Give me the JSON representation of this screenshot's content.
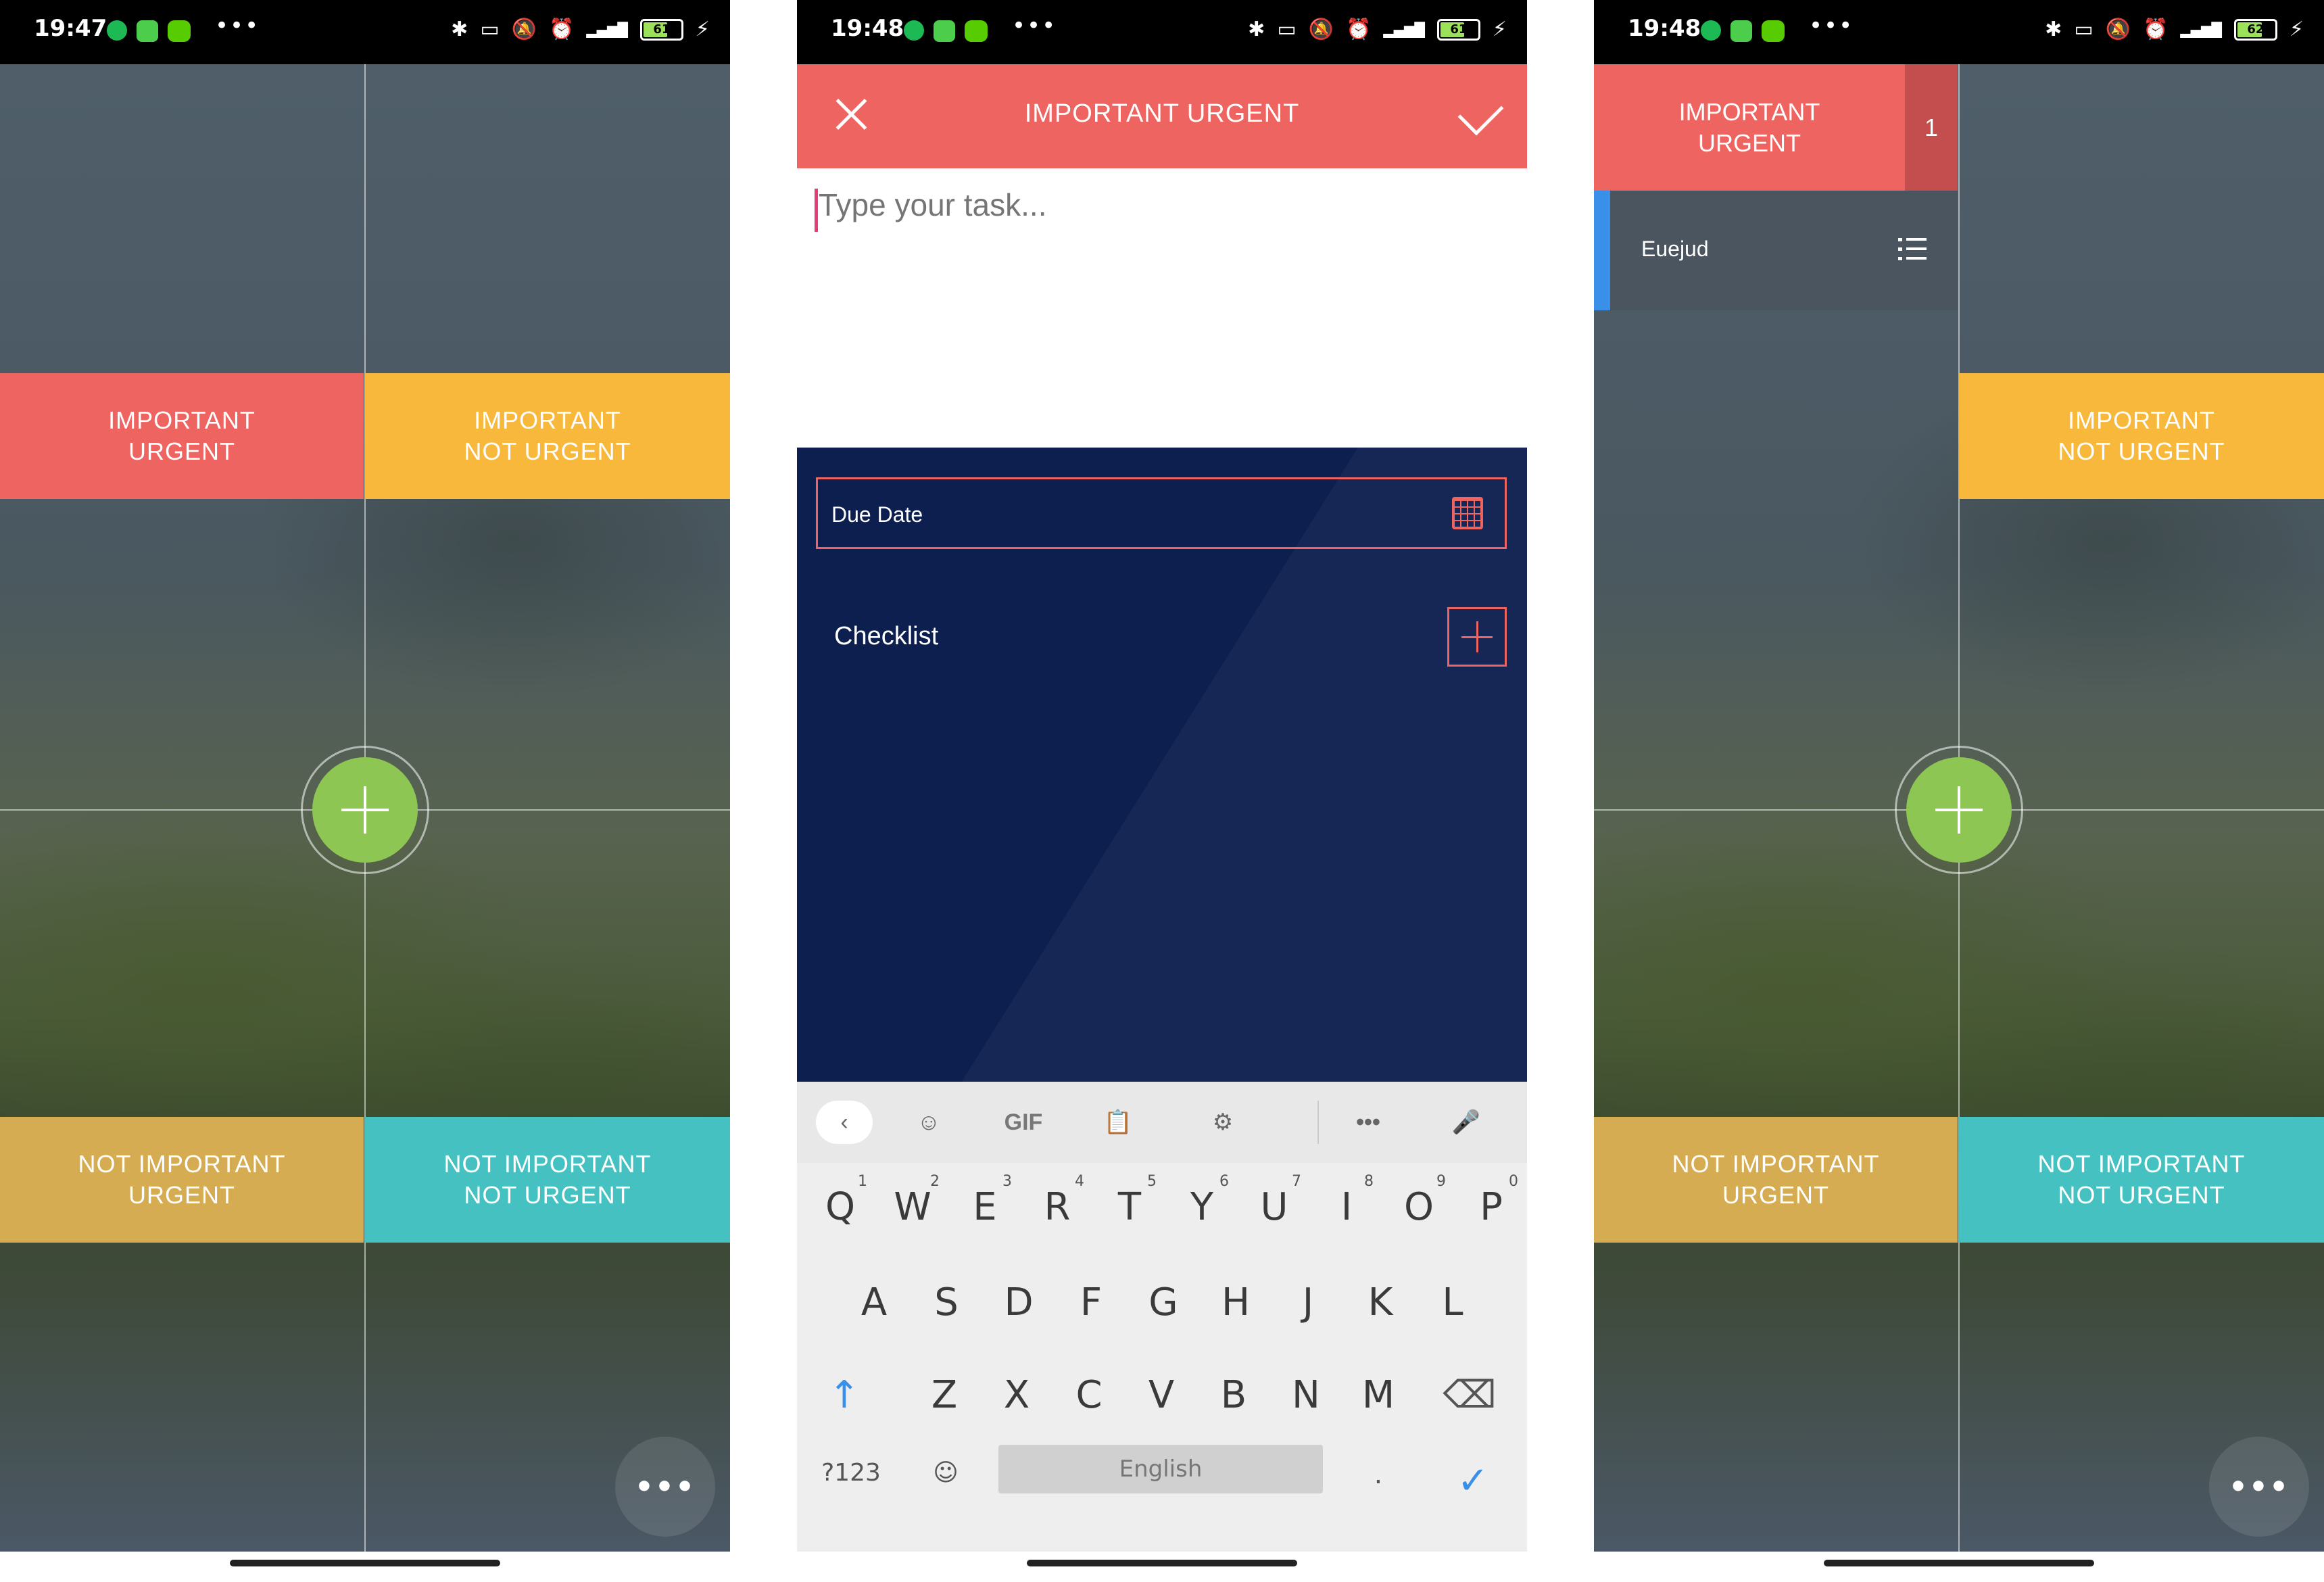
{
  "screens": [
    {
      "status": {
        "time": "19:47",
        "battery": "61"
      },
      "quadrants": {
        "q1": [
          "IMPORTANT",
          "URGENT"
        ],
        "q2": [
          "IMPORTANT",
          "NOT URGENT"
        ],
        "q3": [
          "NOT IMPORTANT",
          "URGENT"
        ],
        "q4": [
          "NOT IMPORTANT",
          "NOT URGENT"
        ]
      }
    },
    {
      "status": {
        "time": "19:48",
        "battery": "61"
      },
      "header": {
        "title": "IMPORTANT URGENT"
      },
      "task_input": {
        "placeholder": "Type your task..."
      },
      "due_date": {
        "label": "Due Date"
      },
      "checklist": {
        "label": "Checklist"
      },
      "keyboard": {
        "gif_label": "GIF",
        "row1": [
          [
            "Q",
            "1"
          ],
          [
            "W",
            "2"
          ],
          [
            "E",
            "3"
          ],
          [
            "R",
            "4"
          ],
          [
            "T",
            "5"
          ],
          [
            "Y",
            "6"
          ],
          [
            "U",
            "7"
          ],
          [
            "I",
            "8"
          ],
          [
            "O",
            "9"
          ],
          [
            "P",
            "0"
          ]
        ],
        "row2": [
          "A",
          "S",
          "D",
          "F",
          "G",
          "H",
          "J",
          "K",
          "L"
        ],
        "row3": [
          "Z",
          "X",
          "C",
          "V",
          "B",
          "N",
          "M"
        ],
        "symbols_label": "?123",
        "space_label": "English",
        "period": "."
      }
    },
    {
      "status": {
        "time": "19:48",
        "battery": "62"
      },
      "list_header": [
        "IMPORTANT",
        "URGENT"
      ],
      "task_count": "1",
      "task_name": "Euejud",
      "quadrants": {
        "q2": [
          "IMPORTANT",
          "NOT URGENT"
        ],
        "q3": [
          "NOT IMPORTANT",
          "URGENT"
        ],
        "q4": [
          "NOT IMPORTANT",
          "NOT URGENT"
        ]
      }
    }
  ],
  "colors": {
    "red": "#ee6461",
    "orange": "#f8b83c",
    "mustard": "#d6ac52",
    "teal": "#45c1c1",
    "fab_green": "#8dc653",
    "panel_navy": "#0d1f4f",
    "task_accent": "#3a8fe8"
  },
  "icons": {
    "status": [
      "spotify-icon",
      "app-icon",
      "duolingo-icon",
      "more-dots-icon",
      "bluetooth-icon",
      "vibrate-icon",
      "mute-icon",
      "alarm-icon",
      "signal-icon",
      "battery-icon",
      "charging-icon"
    ],
    "fab": "plus-icon",
    "menu": "more-horizontal-icon",
    "header": [
      "close-icon",
      "check-icon"
    ],
    "calendar": "calendar-icon",
    "checklist_add": "plus-icon",
    "keyboard_toolbar": [
      "back-chevron-icon",
      "sticker-icon",
      "gif-icon",
      "clipboard-icon",
      "settings-icon",
      "more-icon",
      "mic-icon"
    ],
    "keyboard_keys": [
      "shift-icon",
      "backspace-icon",
      "emoji-icon",
      "enter-check-icon"
    ],
    "task": "list-icon"
  }
}
